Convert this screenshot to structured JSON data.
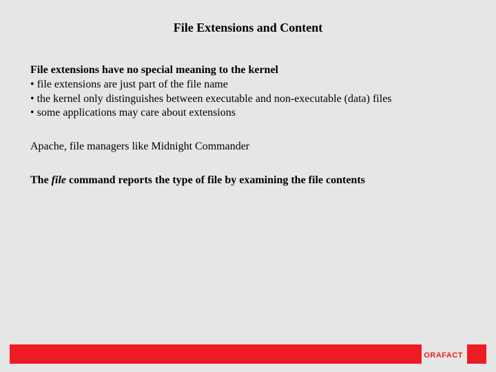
{
  "title": "File Extensions and Content",
  "p1": {
    "heading": "File extensions have no special meaning to the kernel",
    "b1": "• file extensions are just part of the file name",
    "b2": "• the kernel only distinguishes between executable and non-executable (data) files",
    "b3": "• some applications may care about extensions"
  },
  "p2": "Apache, file managers like Midnight Commander",
  "p3": {
    "lead": "The ",
    "cmd": "file",
    "rest": " command reports the type of file by examining the file contents"
  },
  "footer": {
    "brand": "ORAFACT"
  }
}
